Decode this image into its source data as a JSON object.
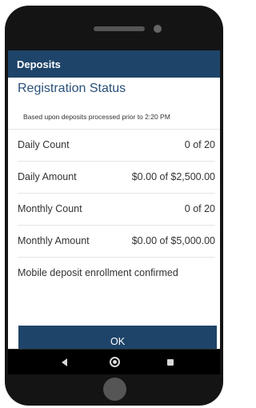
{
  "header": {
    "title": "Deposits"
  },
  "registration": {
    "title": "Registration Status",
    "note": "Based upon deposits processed prior to 2:20 PM",
    "rows": [
      {
        "label": "Daily Count",
        "value": "0 of 20"
      },
      {
        "label": "Daily Amount",
        "value": "$0.00 of $2,500.00"
      },
      {
        "label": "Monthly Count",
        "value": "0 of 20"
      },
      {
        "label": "Monthly Amount",
        "value": "$0.00 of $5,000.00"
      }
    ],
    "confirmation": "Mobile deposit enrollment confirmed"
  },
  "actions": {
    "ok_label": "OK"
  },
  "nav": {
    "back_icon": "back-triangle-icon",
    "home_icon": "home-circle-icon",
    "recents_icon": "recents-square-icon"
  },
  "colors": {
    "brand": "#1e4469",
    "title_text": "#2a5179",
    "body_text": "#333333",
    "phone_frame": "#141414"
  }
}
